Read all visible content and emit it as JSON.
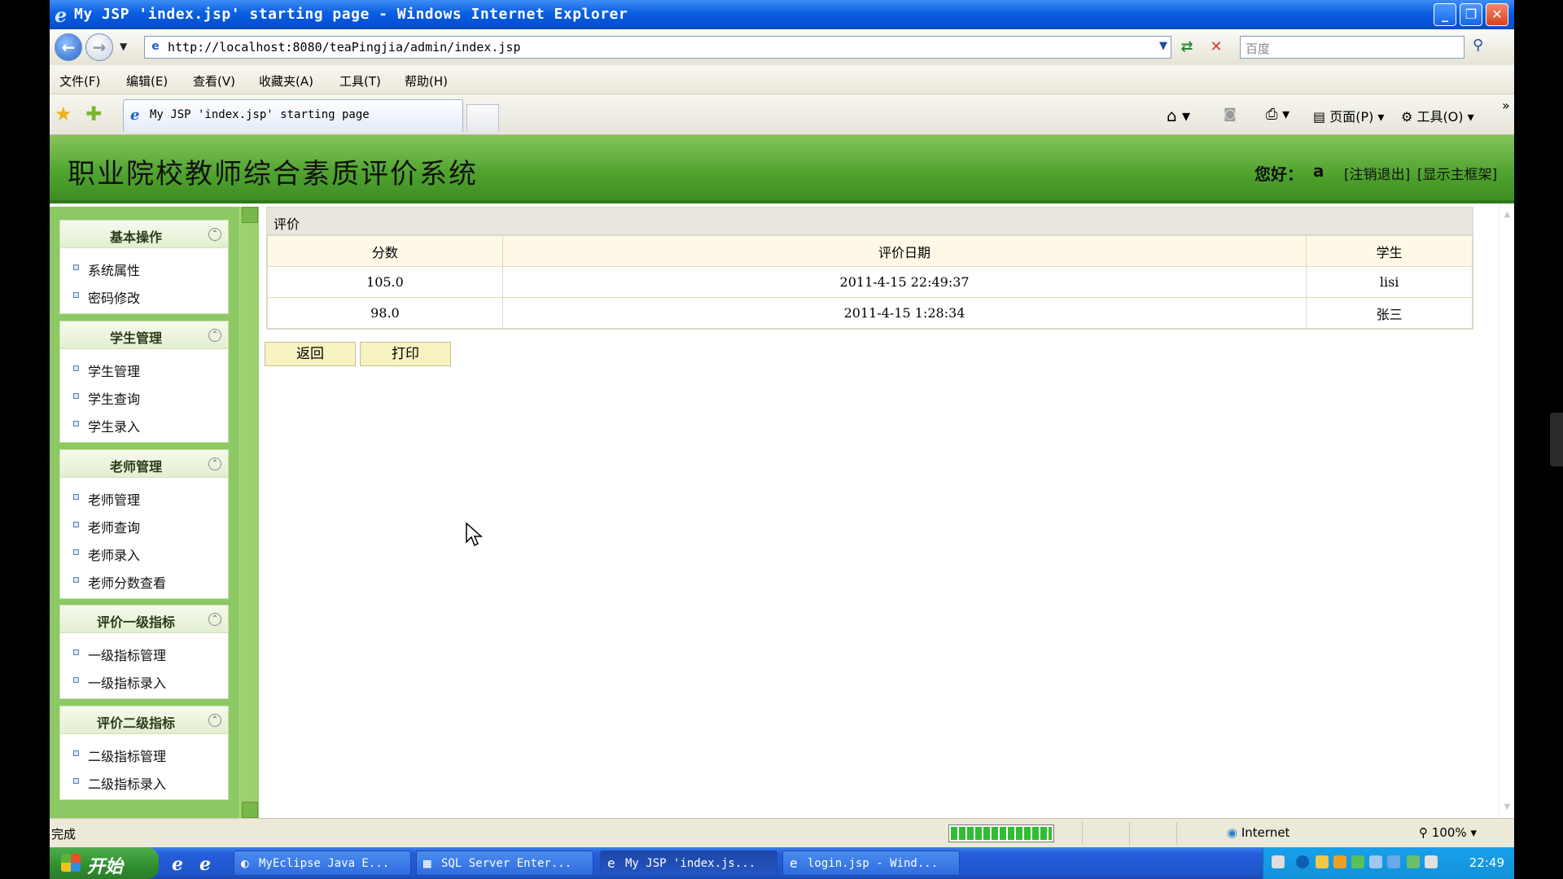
{
  "window": {
    "title": "My JSP 'index.jsp' starting page - Windows Internet Explorer",
    "minimize": "_",
    "restore": "❐",
    "close": "✕"
  },
  "address": {
    "url": "http://localhost:8080/teaPingjia/admin/index.jsp",
    "search_placeholder": "百度"
  },
  "menu": [
    "文件(F)",
    "编辑(E)",
    "查看(V)",
    "收藏夹(A)",
    "工具(T)",
    "帮助(H)"
  ],
  "tab": {
    "label": "My JSP 'index.jsp' starting page"
  },
  "commands": {
    "page": "页面(P)",
    "tools": "工具(O)"
  },
  "app": {
    "title": "职业院校教师综合素质评价系统",
    "greeting": "您好：",
    "user": "a",
    "logout": "[注销退出]",
    "show_frame": "[显示主框架]"
  },
  "sidebar": {
    "groups": [
      {
        "title": "基本操作",
        "items": [
          "系统属性",
          "密码修改"
        ]
      },
      {
        "title": "学生管理",
        "items": [
          "学生管理",
          "学生查询",
          "学生录入"
        ]
      },
      {
        "title": "老师管理",
        "items": [
          "老师管理",
          "老师查询",
          "老师录入",
          "老师分数查看"
        ]
      },
      {
        "title": "评价一级指标",
        "items": [
          "一级指标管理",
          "一级指标录入"
        ]
      },
      {
        "title": "评价二级指标",
        "items": [
          "二级指标管理",
          "二级指标录入"
        ]
      }
    ]
  },
  "content": {
    "caption": "评价",
    "columns": [
      "分数",
      "评价日期",
      "学生"
    ],
    "rows": [
      [
        "105.0",
        "2011-4-15 22:49:37",
        "lisi"
      ],
      [
        "98.0",
        "2011-4-15 1:28:34",
        "张三"
      ]
    ],
    "back_label": "返回",
    "print_label": "打印"
  },
  "status": {
    "text": "完成",
    "zone": "Internet",
    "zoom": "100%",
    "progress": 1.0
  },
  "taskbar": {
    "start": "开始",
    "tasks": [
      {
        "label": "MyEclipse Java E...",
        "active": false
      },
      {
        "label": "SQL Server Enter...",
        "active": false
      },
      {
        "label": "My JSP 'index.js...",
        "active": true
      },
      {
        "label": "login.jsp - Wind...",
        "active": false
      }
    ],
    "clock": "22:49"
  }
}
